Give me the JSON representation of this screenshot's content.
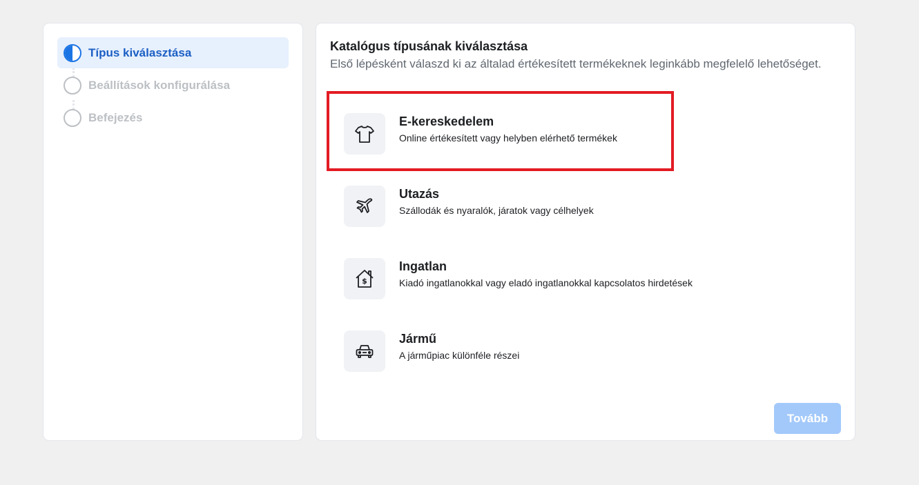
{
  "steps": [
    {
      "label": "Típus kiválasztása",
      "state": "active"
    },
    {
      "label": "Beállítások konfigurálása",
      "state": "pending"
    },
    {
      "label": "Befejezés",
      "state": "pending"
    }
  ],
  "main": {
    "title": "Katalógus típusának kiválasztása",
    "subtitle": "Első lépésként válaszd ki az általad értékesített termékeknek leginkább megfelelő lehetőséget.",
    "options": [
      {
        "title": "E-kereskedelem",
        "description": "Online értékesített vagy helyben elérhető termékek",
        "icon": "tshirt-icon"
      },
      {
        "title": "Utazás",
        "description": "Szállodák és nyaralók, járatok vagy célhelyek",
        "icon": "airplane-icon"
      },
      {
        "title": "Ingatlan",
        "description": "Kiadó ingatlanokkal vagy eladó ingatlanokkal kapcsolatos hirdetések",
        "icon": "house-dollar-icon"
      },
      {
        "title": "Jármű",
        "description": "A járműpiac különféle részei",
        "icon": "car-icon"
      }
    ],
    "next_label": "Tovább"
  },
  "colors": {
    "accent": "#1b74e4",
    "highlight": "#e31b23",
    "button_disabled": "#a3c9fb"
  }
}
